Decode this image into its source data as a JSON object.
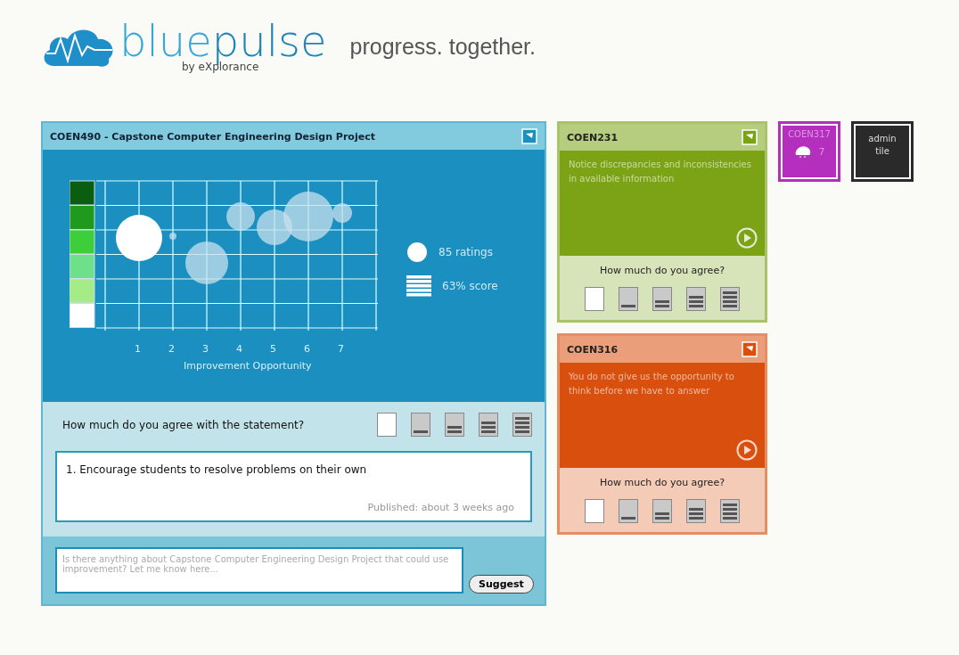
{
  "header": {
    "logo_word_light": "blue",
    "logo_word_dark": "pulse",
    "logo_byline": "by eXplorance",
    "tagline": "progress. together."
  },
  "main_card": {
    "title": "COEN490 - Capstone Computer Engineering Design Project",
    "chart": {
      "x_ticks": [
        "1",
        "2",
        "3",
        "4",
        "5",
        "6",
        "7"
      ],
      "xlabel": "Improvement Opportunity"
    },
    "legend": [
      {
        "kind": "circle",
        "label": "85 ratings"
      },
      {
        "kind": "bars",
        "label": "63% score"
      }
    ],
    "question": "How much do you agree with the statement?",
    "statement": "1.  Encourage students to resolve problems on their own",
    "published": "Published: about 3 weeks ago",
    "suggest": {
      "placeholder": "Is there anything about Capstone Computer Engineering Design Project that could use improvement? Let me know here...",
      "button": "Suggest"
    }
  },
  "side_cards": [
    {
      "title": "COEN231",
      "text": "Notice discrepancies and inconsistencies in available information",
      "question": "How much do you agree?",
      "color": "#7ba315"
    },
    {
      "title": "COEN316",
      "text": "You do not give us the opportunity to think before we have to answer",
      "question": "How much do you agree?",
      "color": "#d9500e"
    }
  ],
  "mini_tiles": [
    {
      "kind": "course",
      "title": "COEN317",
      "count": "7",
      "color": "#b52fbf"
    },
    {
      "kind": "admin",
      "title": "admin tile",
      "color": "#2a2a2a"
    }
  ]
}
